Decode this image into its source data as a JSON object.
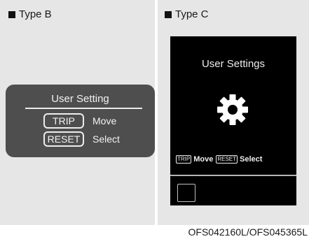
{
  "type_b": {
    "label": "Type B",
    "title": "User Setting",
    "rows": [
      {
        "button": "TRIP",
        "action": "Move"
      },
      {
        "button": "RESET",
        "action": "Select"
      }
    ]
  },
  "type_c": {
    "label": "Type C",
    "title": "User Settings",
    "icon": "gear-icon",
    "rows": [
      {
        "button": "TRIP",
        "action": "Move"
      },
      {
        "button": "RESET",
        "action": "Select"
      }
    ]
  },
  "figure_code": "OFS042160L/OFS045365L"
}
